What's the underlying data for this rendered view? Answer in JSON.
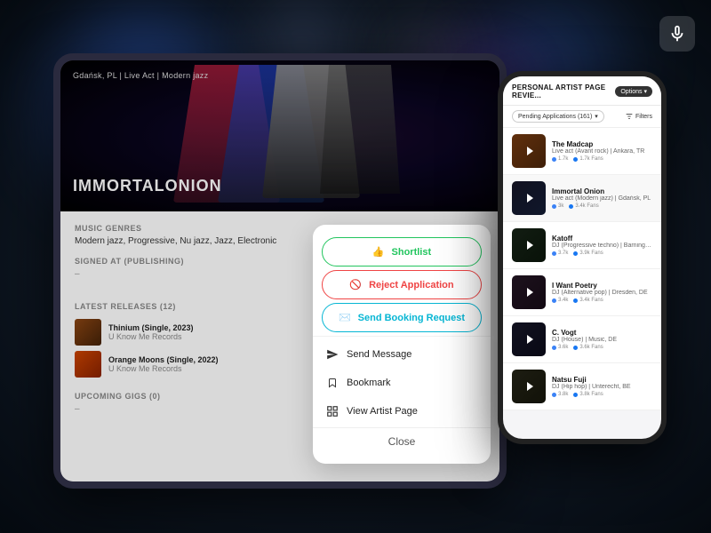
{
  "background": {
    "description": "Dark blue concert background with bokeh lights"
  },
  "logo": {
    "icon": "microphone",
    "symbol": "🎤"
  },
  "tablet": {
    "hero": {
      "location": "Gdańsk, PL | Live Act | Modern jazz",
      "band_name_red": "IMMORTAL",
      "band_name_white": "ONION"
    },
    "music_genres_label": "Music Genres",
    "music_genres_value": "Modern jazz, Progressive, Nu jazz, Jazz, Electronic",
    "signed_label": "Signed at (Publishing)",
    "signed_value": "–",
    "latest_releases_label": "Latest releases (12)",
    "releases": [
      {
        "title": "Thinium (Single, 2023)",
        "label": "U Know Me Records",
        "color": "#8B4513"
      },
      {
        "title": "Orange Moons (Single, 2022)",
        "label": "U Know Me Records",
        "color": "#cc4400"
      }
    ],
    "upcoming_gigs_label": "Upcoming Gigs (0)",
    "upcoming_gigs_value": "–"
  },
  "action_panel": {
    "shortlist_label": "Shortlist",
    "reject_label": "Reject Application",
    "booking_label": "Send Booking Request",
    "send_message_label": "Send Message",
    "bookmark_label": "Bookmark",
    "view_artist_label": "View Artist Page",
    "close_label": "Close"
  },
  "phone": {
    "header_title": "PERSONAL ARTIST PAGE REVIE...",
    "options_label": "Options",
    "pending_label": "Pending Applications (161)",
    "filters_label": "Filters",
    "artists": [
      {
        "name": "The Madcap",
        "genre": "Live act (Avant rock) | Ankara, TR",
        "followers": "1.7k",
        "fans": "1.7k Fans",
        "thumb_class": "thumb-madcap",
        "emoji": "🎸"
      },
      {
        "name": "Immortal Onion",
        "genre": "Live act (Modern jazz) | Gdańsk, PL",
        "followers": "3k",
        "fans": "3.4k Fans",
        "thumb_class": "thumb-onion",
        "emoji": "🎵",
        "active": true
      },
      {
        "name": "Katoff",
        "genre": "DJ (Progressive techno) | Barning, DE",
        "followers": "3.7k",
        "fans": "3.9k Fans",
        "thumb_class": "thumb-katoff",
        "emoji": "🎧"
      },
      {
        "name": "I Want Poetry",
        "genre": "DJ (Alternative pop) | Dresden, DE",
        "followers": "3.4k",
        "fans": "3.4k Fans",
        "thumb_class": "thumb-poetry",
        "emoji": "🎤"
      },
      {
        "name": "C. Vogt",
        "genre": "DJ (House) | Music, DE",
        "followers": "3.6k",
        "fans": "3.6k Fans",
        "thumb_class": "thumb-vogt",
        "emoji": "🎶"
      },
      {
        "name": "Natsu Fuji",
        "genre": "DJ (Hip hop) | Unterecht, BE",
        "followers": "3.8k",
        "fans": "3.8k Fans",
        "thumb_class": "thumb-fuji",
        "emoji": "🎵"
      }
    ]
  }
}
